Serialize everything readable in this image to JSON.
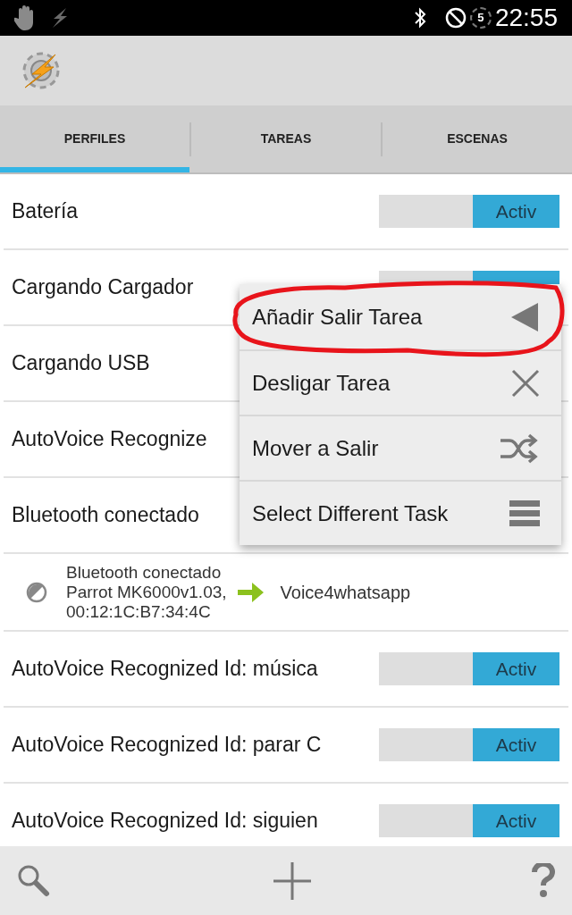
{
  "status_bar": {
    "time": "22:55",
    "timer_badge": "5"
  },
  "tabs": [
    {
      "label": "PERFILES",
      "selected": true
    },
    {
      "label": "TAREAS",
      "selected": false
    },
    {
      "label": "ESCENAS",
      "selected": false
    }
  ],
  "profiles": [
    {
      "name": "Batería",
      "on": true,
      "toggle_label": "Activ"
    },
    {
      "name": "Cargando Cargador",
      "on": true
    },
    {
      "name": "Cargando USB"
    },
    {
      "name": "AutoVoice Recognize"
    },
    {
      "name": "Bluetooth conectado",
      "expanded": true,
      "detail": {
        "context_lines": [
          "Bluetooth conectado",
          "Parrot MK6000v1.03,",
          "00:12:1C:B7:34:4C"
        ],
        "task": "Voice4whatsapp"
      }
    },
    {
      "name": "AutoVoice Recognized Id: música",
      "on": true,
      "toggle_label": "Activ"
    },
    {
      "name": "AutoVoice Recognized Id: parar C",
      "on": true,
      "toggle_label": "Activ"
    },
    {
      "name": "AutoVoice Recognized Id: siguien",
      "on": true,
      "toggle_label": "Activ"
    }
  ],
  "context_menu": {
    "items": [
      {
        "label": "Añadir Salir Tarea",
        "highlighted": true
      },
      {
        "label": "Desligar Tarea",
        "highlighted": false
      },
      {
        "label": "Mover a Salir",
        "highlighted": false
      },
      {
        "label": "Select Different Task",
        "highlighted": false
      }
    ]
  }
}
